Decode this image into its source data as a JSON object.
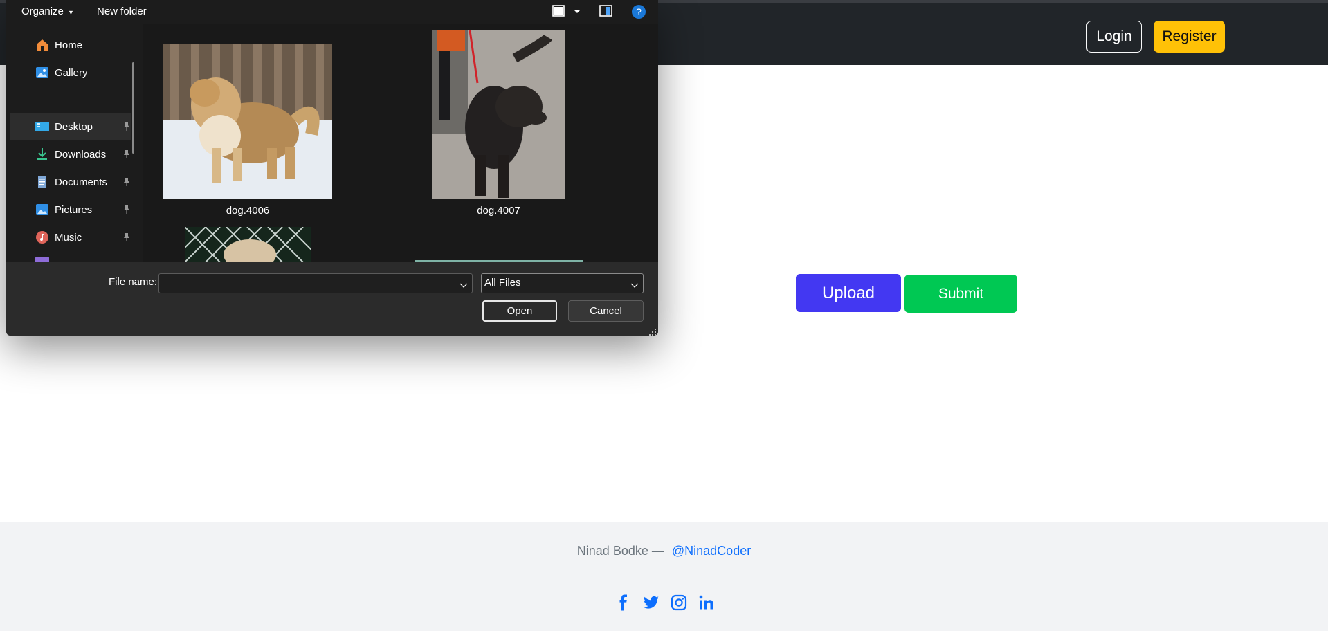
{
  "site": {
    "nav": {
      "login_label": "Login",
      "register_label": "Register"
    },
    "actions": {
      "upload_label": "Upload",
      "submit_label": "Submit"
    },
    "footer": {
      "author": "Ninad Bodke —",
      "handle": "@NinadCoder",
      "social_icons": [
        "facebook-icon",
        "twitter-icon",
        "instagram-icon",
        "linkedin-icon"
      ]
    },
    "colors": {
      "navbar": "#212529",
      "register": "#ffc107",
      "upload": "#4338f2",
      "submit": "#00c853",
      "link": "#0d6efd"
    }
  },
  "dialog": {
    "toolbar": {
      "organize_label": "Organize",
      "new_folder_label": "New folder"
    },
    "nav": {
      "quick": [
        {
          "label": "Home",
          "icon": "home-icon"
        },
        {
          "label": "Gallery",
          "icon": "gallery-icon"
        }
      ],
      "pinned": [
        {
          "label": "Desktop",
          "icon": "desktop-icon",
          "selected": true
        },
        {
          "label": "Downloads",
          "icon": "downloads-icon"
        },
        {
          "label": "Documents",
          "icon": "documents-icon"
        },
        {
          "label": "Pictures",
          "icon": "pictures-icon"
        },
        {
          "label": "Music",
          "icon": "music-icon"
        }
      ]
    },
    "files": [
      {
        "name": "dog.4006"
      },
      {
        "name": "dog.4007"
      }
    ],
    "file_name_label": "File name:",
    "file_name_value": "",
    "filter_value": "All Files",
    "open_label": "Open",
    "cancel_label": "Cancel"
  }
}
